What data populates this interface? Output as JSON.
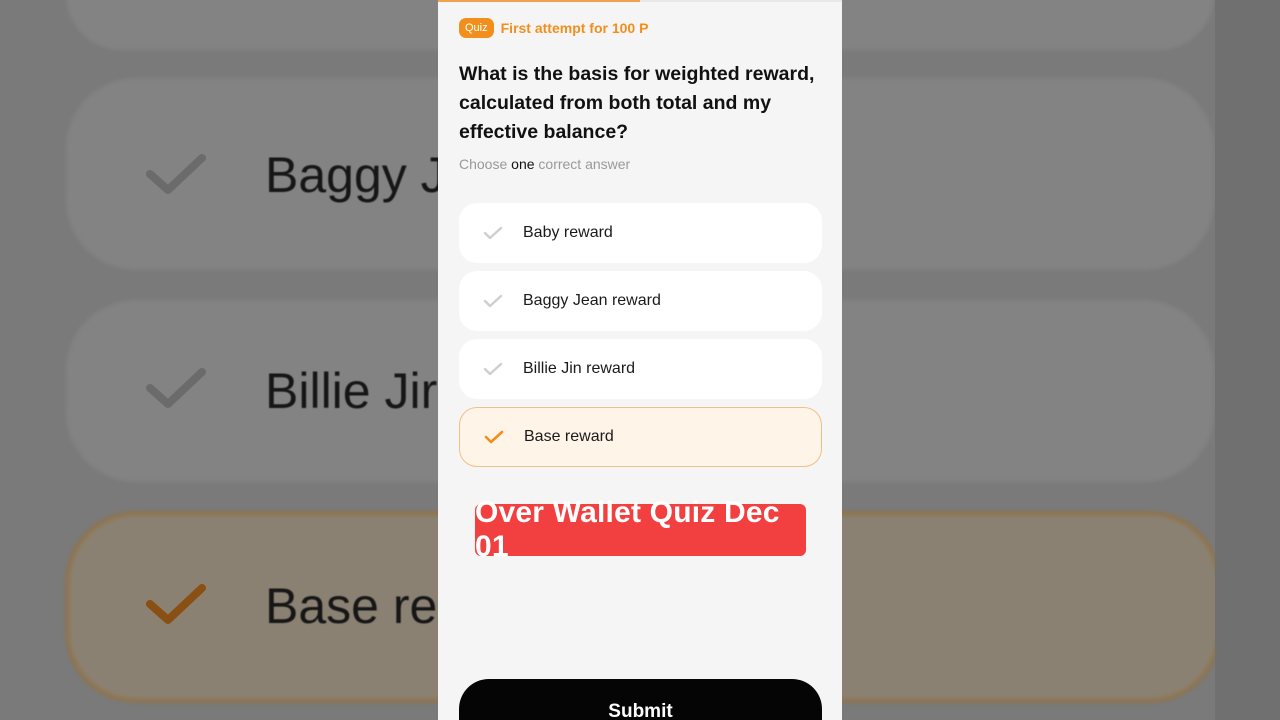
{
  "colors": {
    "accent": "#f28f1c",
    "banner": "#f24040",
    "submit": "#050505",
    "selected_bg": "#fff4e8"
  },
  "header": {
    "badge": "Quiz",
    "attempt_text": "First attempt for 100 P",
    "progress_fraction": 0.5
  },
  "question": {
    "text": "What is the basis for weighted reward, calculated from both total and my effective balance?",
    "hint_before": "Choose ",
    "hint_emphasis": "one",
    "hint_after": " correct answer"
  },
  "options": [
    {
      "label": "Baby reward",
      "selected": false
    },
    {
      "label": "Baggy Jean reward",
      "selected": false
    },
    {
      "label": "Billie Jin reward",
      "selected": false
    },
    {
      "label": "Base reward",
      "selected": true
    }
  ],
  "banner": {
    "text": "Over Wallet Quiz Dec 01"
  },
  "submit": {
    "label": "Submit"
  },
  "background": {
    "items": [
      {
        "text": "Baggy J"
      },
      {
        "text": "Billie Jir"
      },
      {
        "text": "Base re"
      }
    ]
  },
  "icons": {
    "option": "check-icon"
  }
}
